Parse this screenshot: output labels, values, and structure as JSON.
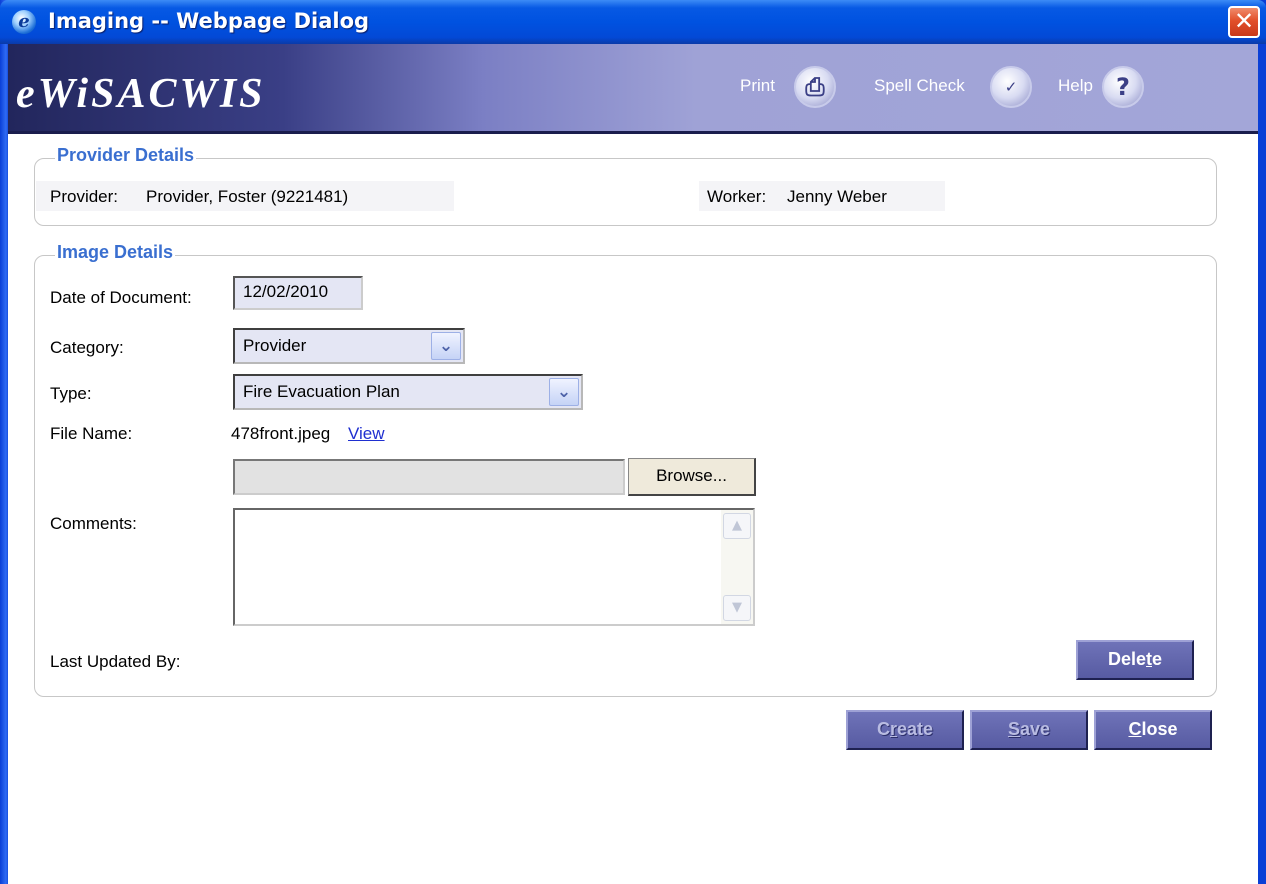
{
  "window": {
    "title": "Imaging -- Webpage Dialog",
    "close_glyph": "✕"
  },
  "banner": {
    "brand": "eWiSACWIS",
    "print_label": "Print",
    "spell_check_label": "Spell Check",
    "help_label": "Help",
    "print_icon": "printer-icon",
    "spell_icon": "spell-check-icon",
    "help_icon": "help-icon"
  },
  "provider_details": {
    "legend": "Provider Details",
    "provider_label": "Provider:",
    "provider_value": "Provider, Foster (9221481)",
    "worker_label": "Worker:",
    "worker_value": "Jenny Weber"
  },
  "image_details": {
    "legend": "Image Details",
    "date_label": "Date of Document:",
    "date_value": "12/02/2010",
    "category_label": "Category:",
    "category_value": "Provider",
    "type_label": "Type:",
    "type_value": "Fire Evacuation Plan",
    "file_name_label": "File Name:",
    "file_name_value": "478front.jpeg",
    "view_link": "View",
    "browse_label": "Browse...",
    "file_input_value": "",
    "comments_label": "Comments:",
    "comments_value": "",
    "last_updated_label": "Last Updated By:",
    "last_updated_value": "",
    "delete": {
      "pre": "Dele",
      "accel": "t",
      "post": "e"
    }
  },
  "footer": {
    "create": {
      "pre": "C",
      "accel": "r",
      "post": "eate"
    },
    "save": {
      "pre": "",
      "accel": "S",
      "post": "ave"
    },
    "close": {
      "pre": "",
      "accel": "C",
      "post": "lose"
    }
  },
  "colors": {
    "title_bar": "#0052e0",
    "banner_dark": "#22265c",
    "legend": "#3a6fd0",
    "button": "#575ba2",
    "link": "#1f2fd0"
  }
}
